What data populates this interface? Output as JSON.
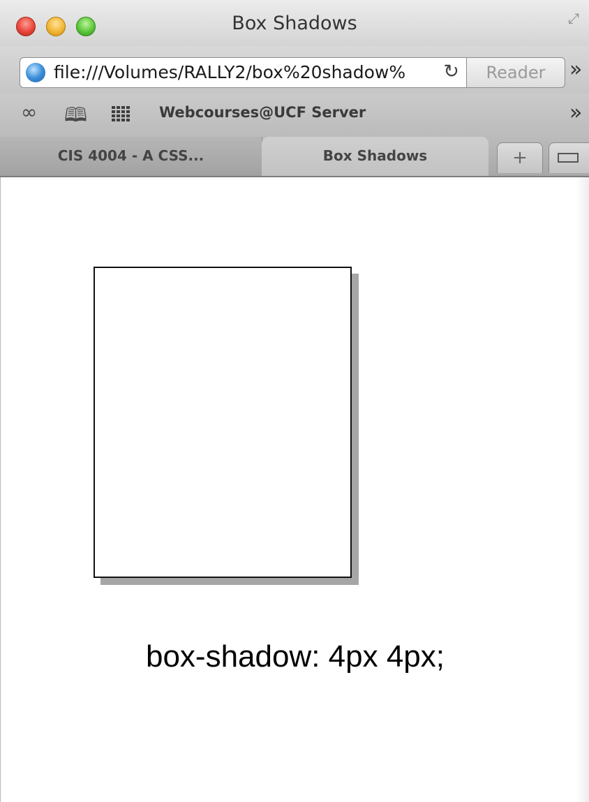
{
  "window": {
    "title": "Box Shadows"
  },
  "toolbar": {
    "url": "file:///Volumes/RALLY2/box%20shadow%",
    "reader_label": "Reader",
    "reload_symbol": "↻",
    "overflow_symbol": "»"
  },
  "bookmarks": {
    "items": [
      {
        "label": "Webcourses@UCF Server"
      }
    ],
    "overflow_symbol": "»"
  },
  "tabs": [
    {
      "label": "CIS 4004 - A CSS...",
      "active": false
    },
    {
      "label": "Box Shadows",
      "active": true
    }
  ],
  "tabbar": {
    "new_tab_symbol": "+"
  },
  "content": {
    "caption": "box-shadow: 4px 4px;"
  },
  "colors": {
    "shadow": "#a6a6a6",
    "box_border": "#111111",
    "close": "#e8443a",
    "minimize": "#f2b534",
    "zoom": "#5cc63b"
  },
  "icons": [
    "close-icon",
    "minimize-icon",
    "zoom-icon",
    "fullscreen-icon",
    "globe-icon",
    "reload-icon",
    "reading-list-icon",
    "bookmarks-book-icon",
    "top-sites-grid-icon",
    "tab-view-icon"
  ]
}
